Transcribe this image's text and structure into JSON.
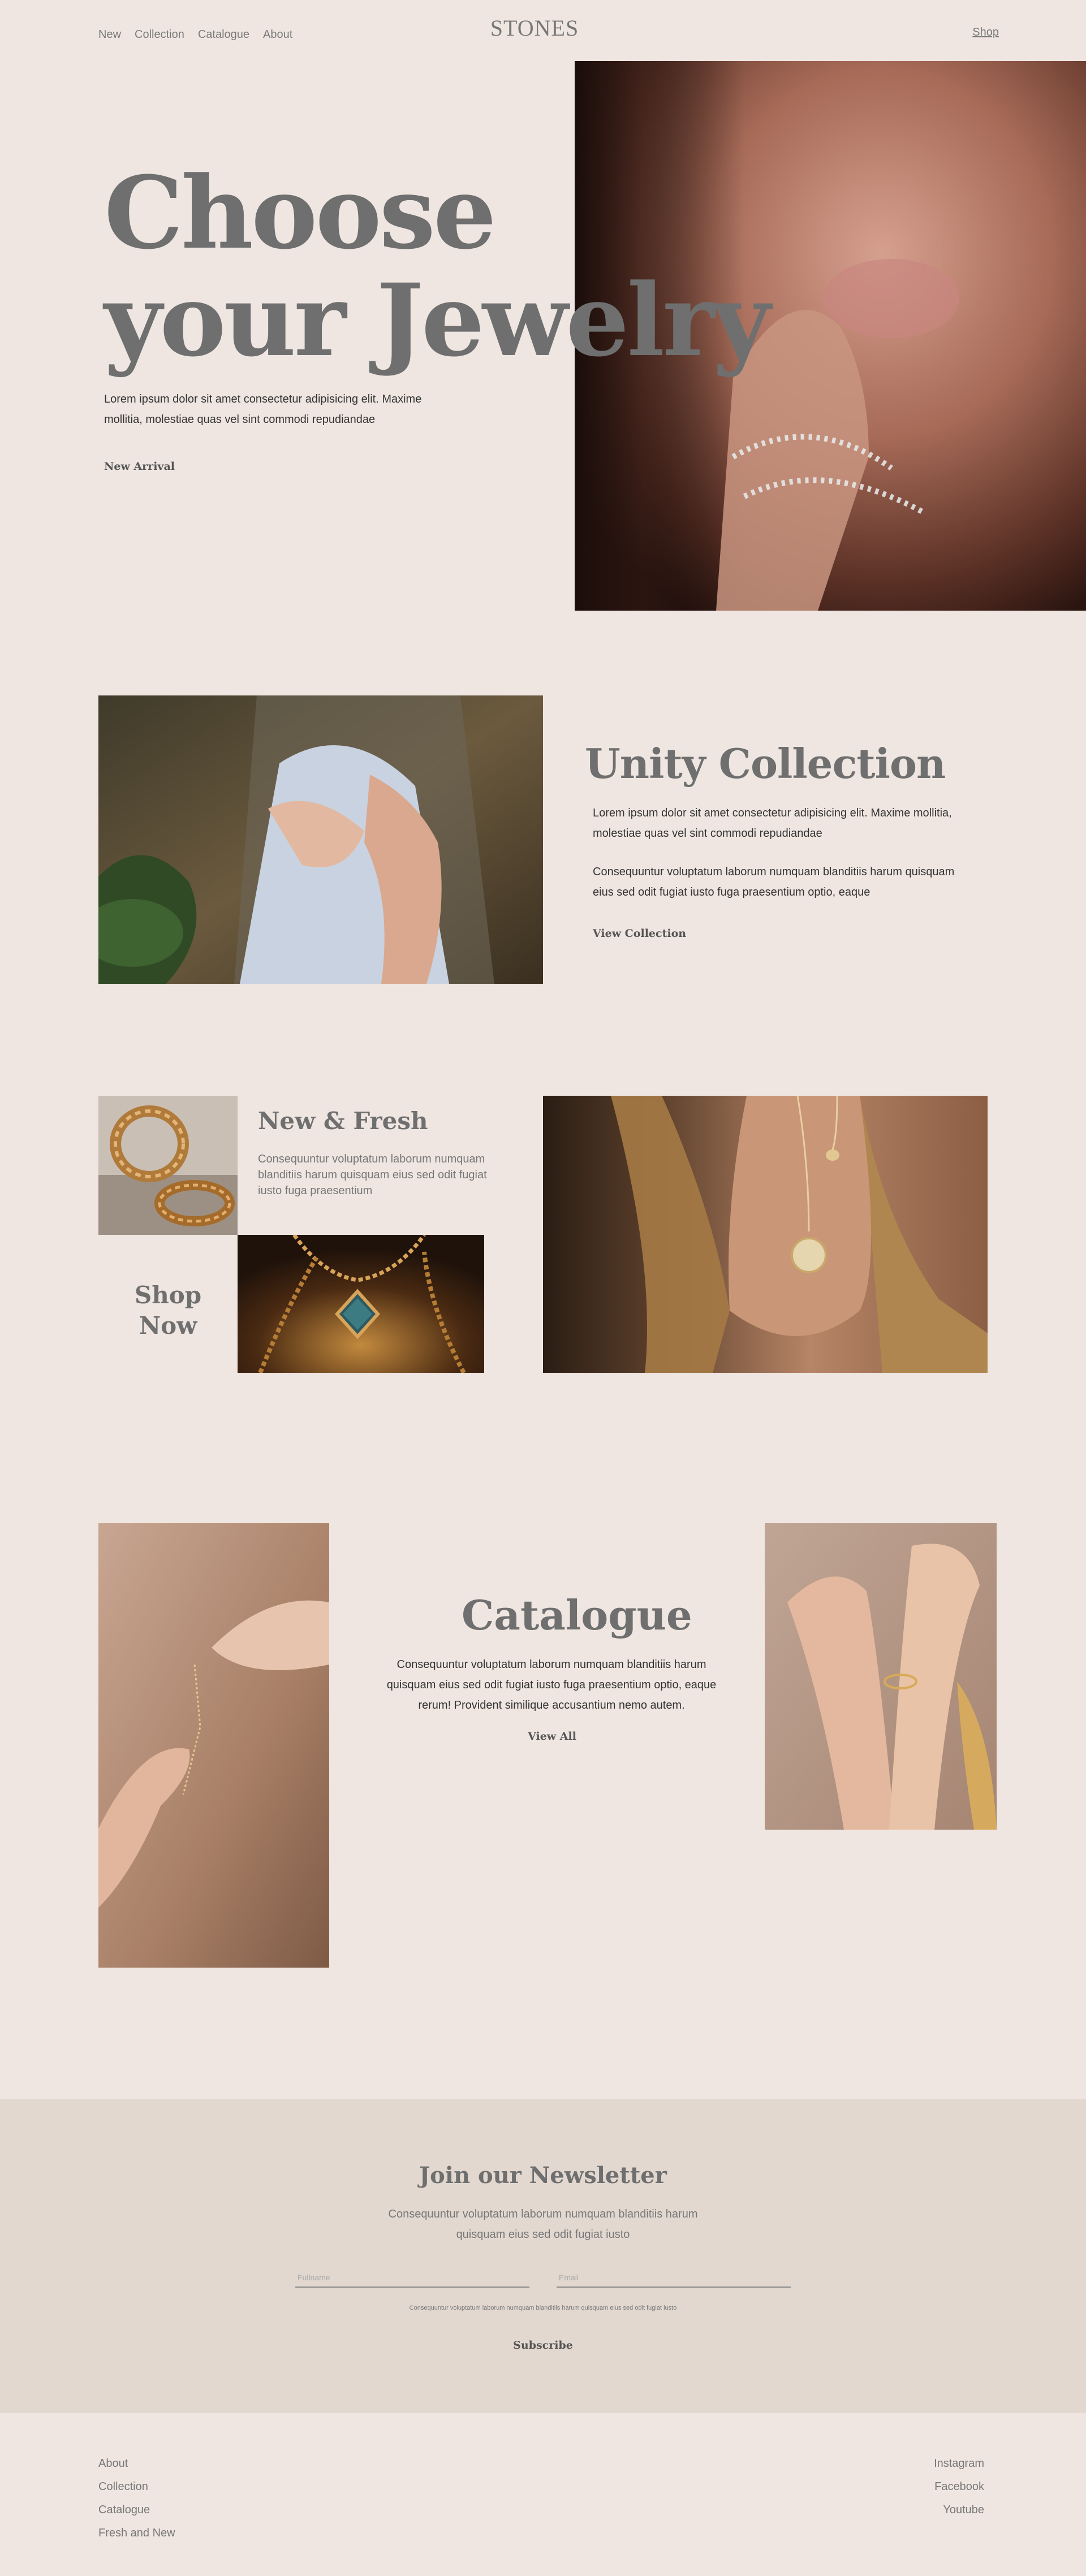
{
  "header": {
    "nav": [
      "New",
      "Collection",
      "Catalogue",
      "About"
    ],
    "logo": "STONES",
    "shop": "Shop"
  },
  "hero": {
    "title_line1": "Choose",
    "title_line2": "your Jewelry",
    "text": "Lorem ipsum dolor sit amet consectetur adipisicing elit. Maxime mollitia, molestiae quas vel sint commodi repudiandae",
    "link": "New Arrival"
  },
  "unity": {
    "title": "Unity Collection",
    "text1": "Lorem ipsum dolor sit amet consectetur adipisicing elit. Maxime mollitia, molestiae quas vel sint commodi repudiandae",
    "text2": "Consequuntur voluptatum laborum numquam blanditiis harum quisquam eius sed odit fugiat iusto fuga praesentium optio, eaque",
    "link": "View Collection"
  },
  "fresh": {
    "title": "New & Fresh",
    "text": "Consequuntur voluptatum laborum numquam blanditiis harum quisquam eius sed odit fugiat iusto fuga praesentium",
    "shop_line1": "Shop",
    "shop_line2": "Now"
  },
  "catalogue": {
    "title": "Catalogue",
    "text": "Consequuntur voluptatum laborum numquam blanditiis harum quisquam eius sed odit fugiat iusto fuga praesentium optio, eaque rerum! Provident similique accusantium nemo autem.",
    "link": "View All"
  },
  "newsletter": {
    "title": "Join our Newsletter",
    "text": "Consequuntur voluptatum laborum numquam blanditiis harum quisquam eius sed odit fugiat iusto",
    "fullname_placeholder": "Fullname",
    "email_placeholder": "Email",
    "note": "Consequuntur voluptatum laborum numquam blanditiis harum quisquam eius sed odit fugiat iusto",
    "button": "Subscribe"
  },
  "footer": {
    "left": [
      "About",
      "Collection",
      "Catalogue",
      "Fresh and New"
    ],
    "right": [
      "Instagram",
      "Facebook",
      "Youtube"
    ]
  },
  "colors": {
    "background": "#efe6e1",
    "newsletter_bg": "#e2d8d0",
    "heading": "#6f6f6f"
  }
}
